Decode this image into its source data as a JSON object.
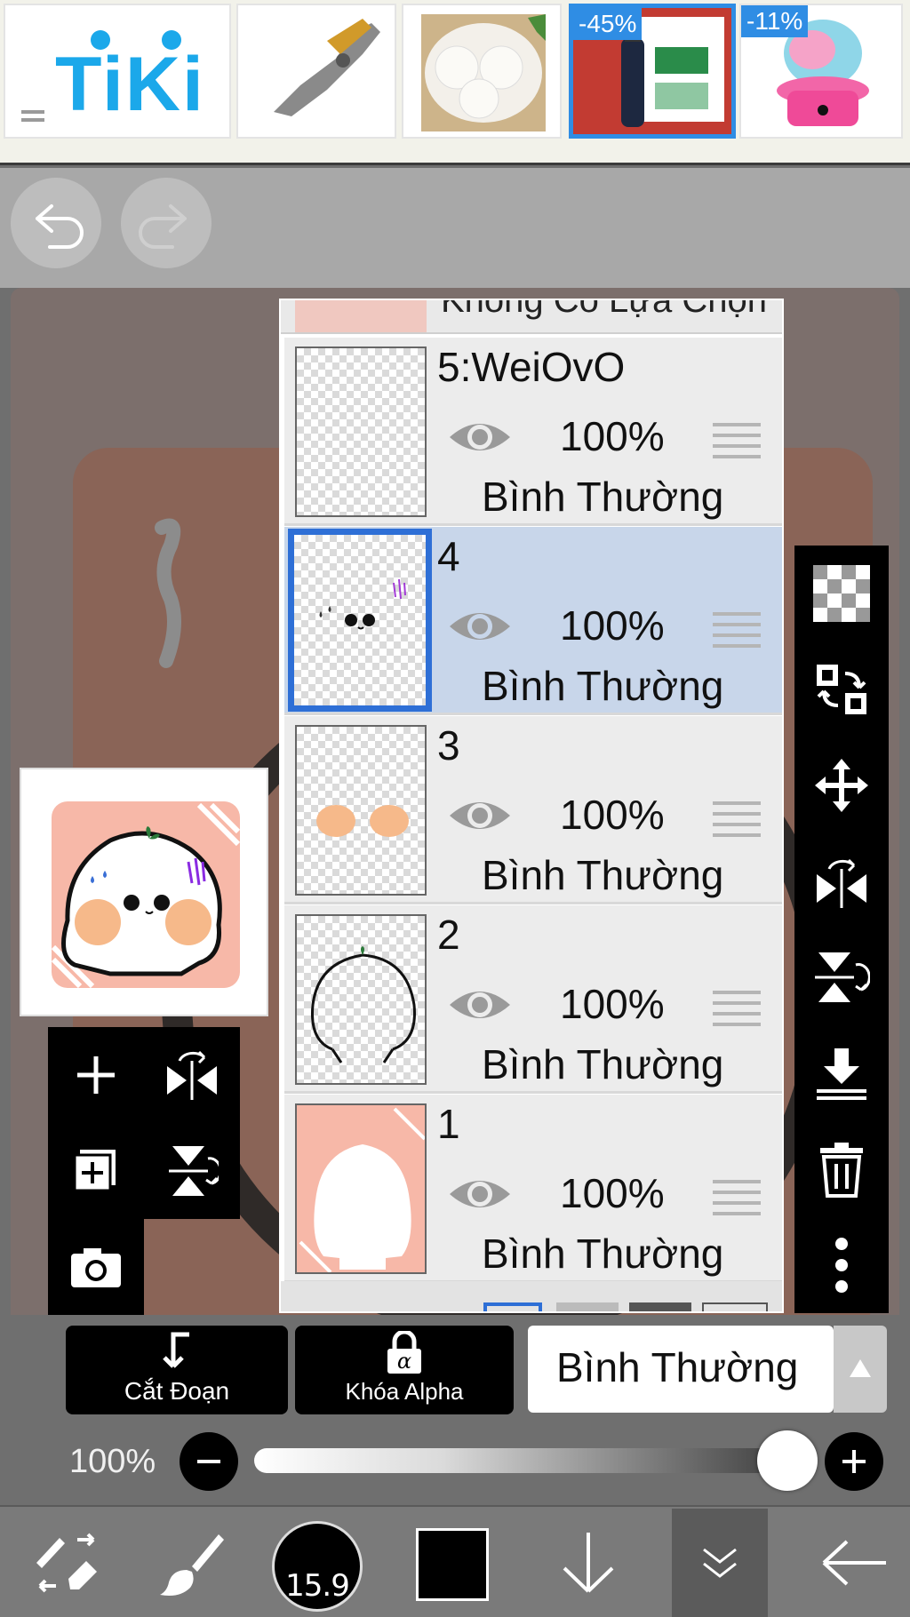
{
  "ad": {
    "brand": "TiKi",
    "items": [
      {
        "discount": "",
        "name": "locking-pliers"
      },
      {
        "discount": "",
        "name": "steamed-buns"
      },
      {
        "discount": "-45%",
        "name": "thermos-bottle"
      },
      {
        "discount": "-11%",
        "name": "cotton-candy-machine"
      }
    ]
  },
  "layer_panel": {
    "top_cut_text": "Không Có Lựa Chọn",
    "layers": [
      {
        "name": "5:WeiOvO",
        "opacity": "100%",
        "blend": "Bình Thường",
        "selected": false
      },
      {
        "name": "4",
        "opacity": "100%",
        "blend": "Bình Thường",
        "selected": true
      },
      {
        "name": "3",
        "opacity": "100%",
        "blend": "Bình Thường",
        "selected": false
      },
      {
        "name": "2",
        "opacity": "100%",
        "blend": "Bình Thường",
        "selected": false
      },
      {
        "name": "1",
        "opacity": "100%",
        "blend": "Bình Thường",
        "selected": false
      }
    ]
  },
  "controls": {
    "clipping_label": "Cắt Đoạn",
    "alpha_lock_label": "Khóa Alpha",
    "blend_mode": "Bình Thường",
    "opacity_label": "100%",
    "opacity_value": 1.0
  },
  "toolbar": {
    "brush_size": "15.9",
    "color": "#000000"
  },
  "colors": {
    "accent": "#2e6fd6",
    "selected_row": "#c8d6ea",
    "ad_blue": "#1ba8ea",
    "character_blush": "#f6b98a",
    "sticker_bg": "#f7b8a8"
  }
}
